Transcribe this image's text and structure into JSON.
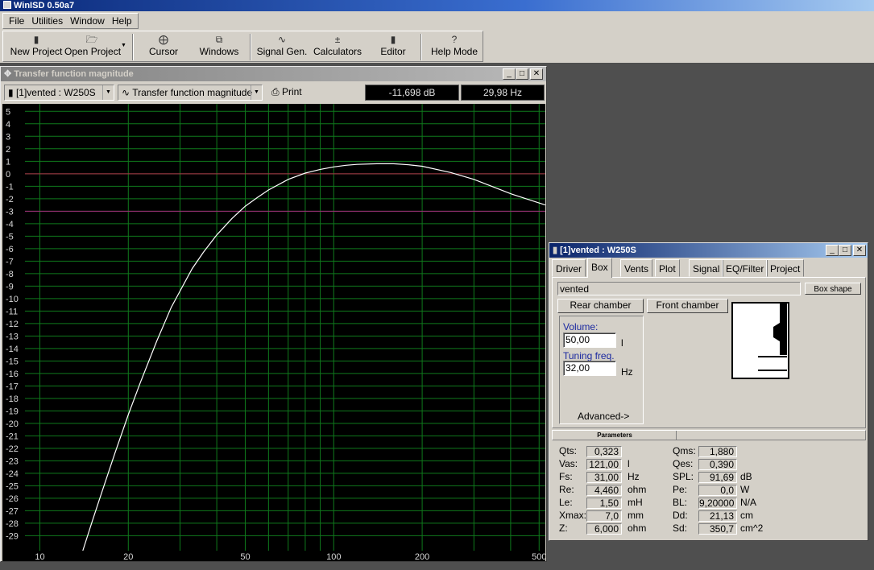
{
  "app": {
    "title": "WinISD 0.50a7"
  },
  "menu": [
    "File",
    "Utilities",
    "Window",
    "Help"
  ],
  "toolbar": [
    {
      "label": "New Project",
      "icon": "new-project-icon"
    },
    {
      "label": "Open Project",
      "icon": "open-folder-icon"
    },
    {
      "label": "Cursor",
      "icon": "cursor-crosshair-icon"
    },
    {
      "label": "Windows",
      "icon": "windows-icon"
    },
    {
      "label": "Signal Gen.",
      "icon": "sine-wave-icon"
    },
    {
      "label": "Calculators",
      "icon": "calculator-icon"
    },
    {
      "label": "Editor",
      "icon": "editor-icon"
    },
    {
      "label": "Help Mode",
      "icon": "help-question-icon"
    }
  ],
  "tf_window": {
    "title": "Transfer function magnitude",
    "project_combo": "[1]vented : W250S",
    "graph_combo": "Transfer function magnitude",
    "print_label": "Print",
    "readout_db": "-11,698 dB",
    "readout_hz": "29,98 Hz"
  },
  "chart_data": {
    "type": "line",
    "title": "",
    "xlabel": "",
    "ylabel": "",
    "x_scale": "log",
    "xlim": [
      8.9,
      525
    ],
    "ylim": [
      -30.2,
      5.6
    ],
    "x_tick_labels": [
      "10",
      "20",
      "50",
      "100",
      "200",
      "500"
    ],
    "y_tick_labels": [
      "5",
      "4",
      "3",
      "2",
      "1",
      "0",
      "-1",
      "-2",
      "-3",
      "-4",
      "-5",
      "-6",
      "-7",
      "-8",
      "-9",
      "-10",
      "-11",
      "-12",
      "-13",
      "-14",
      "-15",
      "-16",
      "-17",
      "-18",
      "-19",
      "-20",
      "-21",
      "-22",
      "-23",
      "-24",
      "-25",
      "-26",
      "-27",
      "-28",
      "-29"
    ],
    "grid": true,
    "reference_lines": [
      {
        "y": 0,
        "color": "#b03048"
      },
      {
        "y": -3,
        "color": "#a02878"
      }
    ],
    "series": [
      {
        "color": "#ffffff",
        "x": [
          14,
          15,
          16,
          18,
          20,
          22,
          25,
          28,
          30,
          33,
          36,
          40,
          45,
          50,
          55,
          60,
          70,
          80,
          90,
          100,
          110,
          120,
          140,
          160,
          180,
          200,
          250,
          300,
          400,
          525
        ],
        "y": [
          -30.2,
          -28.0,
          -26.0,
          -22.4,
          -19.3,
          -16.7,
          -13.4,
          -10.7,
          -9.4,
          -7.6,
          -6.3,
          -4.9,
          -3.6,
          -2.6,
          -1.9,
          -1.3,
          -0.45,
          0.05,
          0.35,
          0.55,
          0.68,
          0.75,
          0.8,
          0.8,
          0.72,
          0.6,
          0.1,
          -0.45,
          -1.6,
          -2.5
        ]
      }
    ]
  },
  "box_window": {
    "title": "[1]vented : W250S",
    "tabs": [
      "Driver",
      "Box",
      "Vents",
      "Plot",
      "Signal",
      "EQ/Filter",
      "Project"
    ],
    "selected_tab": "Box",
    "box_type": "vented",
    "box_shape_button": "Box shape",
    "rear_chamber": "Rear chamber",
    "front_chamber": "Front chamber",
    "volume_label": "Volume:",
    "volume_value": "50,00",
    "volume_unit": "l",
    "tuning_label": "Tuning freq.",
    "tuning_value": "32,00",
    "tuning_unit": "Hz",
    "advanced": "Advanced->",
    "params_header": "Parameters"
  },
  "params_left": [
    {
      "label": "Qts:",
      "value": "0,323",
      "unit": ""
    },
    {
      "label": "Vas:",
      "value": "121,00",
      "unit": "l"
    },
    {
      "label": "Fs:",
      "value": "31,00",
      "unit": "Hz"
    },
    {
      "label": "Re:",
      "value": "4,460",
      "unit": "ohm"
    },
    {
      "label": "Le:",
      "value": "1,50",
      "unit": "mH"
    },
    {
      "label": "Xmax:",
      "value": "7,0",
      "unit": "mm"
    },
    {
      "label": "Z:",
      "value": "6,000",
      "unit": "ohm"
    }
  ],
  "params_right": [
    {
      "label": "Qms:",
      "value": "1,880",
      "unit": ""
    },
    {
      "label": "Qes:",
      "value": "0,390",
      "unit": ""
    },
    {
      "label": "SPL:",
      "value": "91,69",
      "unit": "dB"
    },
    {
      "label": "Pe:",
      "value": "0,0",
      "unit": "W"
    },
    {
      "label": "BL:",
      "value": "9,20000",
      "unit": "N/A"
    },
    {
      "label": "Dd:",
      "value": "21,13",
      "unit": "cm"
    },
    {
      "label": "Sd:",
      "value": "350,7",
      "unit": "cm^2"
    }
  ]
}
